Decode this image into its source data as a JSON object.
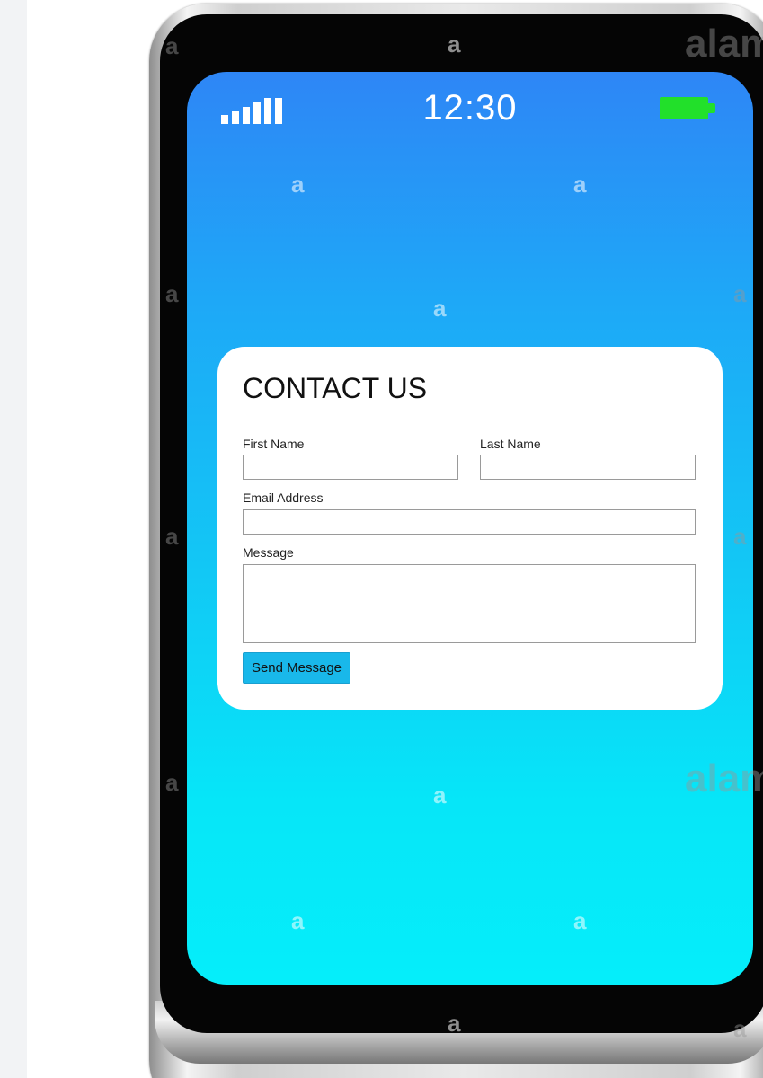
{
  "status_bar": {
    "time": "12:30",
    "signal_icon": "signal-bars-icon",
    "battery_icon": "battery-icon",
    "battery_color": "#22e02a"
  },
  "contact_form": {
    "title": "CONTACT US",
    "first_name": {
      "label": "First Name",
      "value": ""
    },
    "last_name": {
      "label": "Last Name",
      "value": ""
    },
    "email": {
      "label": "Email Address",
      "value": ""
    },
    "message": {
      "label": "Message",
      "value": ""
    },
    "submit_label": "Send Message",
    "submit_color": "#19b8ea"
  },
  "watermark": {
    "glyph": "a",
    "wordmark": "alam"
  },
  "colors": {
    "screen_top": "#2e86f6",
    "screen_bottom": "#05eefa"
  }
}
